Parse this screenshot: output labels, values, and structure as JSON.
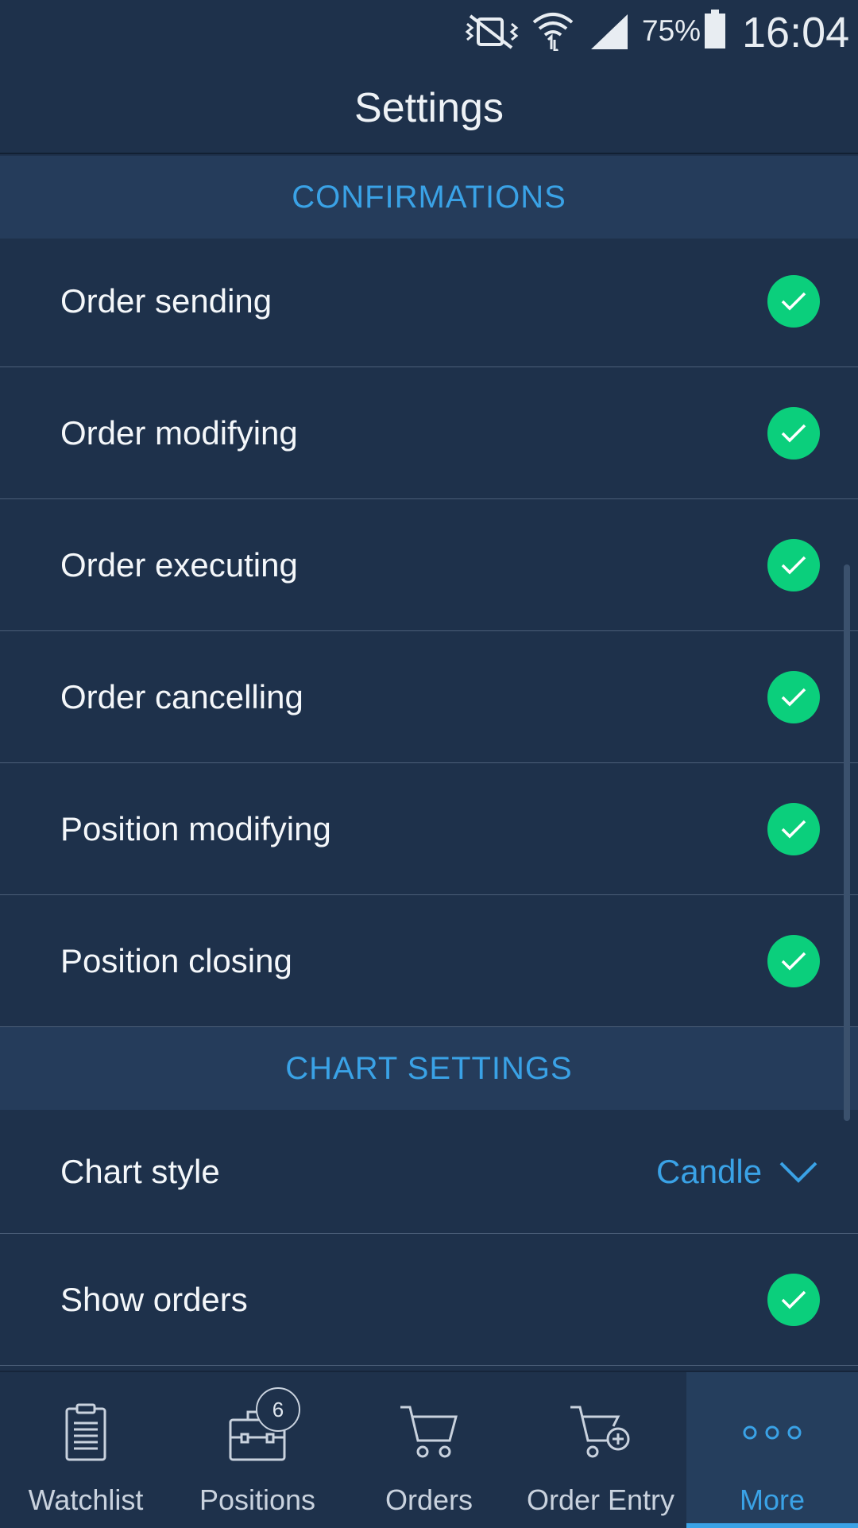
{
  "status_bar": {
    "battery_percent": "75%",
    "time": "16:04",
    "icons": [
      "vibrate-off-icon",
      "wifi-icon",
      "signal-icon",
      "battery-icon"
    ]
  },
  "header": {
    "title": "Settings"
  },
  "sections": {
    "confirmations": {
      "title": "CONFIRMATIONS",
      "items": [
        {
          "label": "Order sending",
          "checked": true
        },
        {
          "label": "Order modifying",
          "checked": true
        },
        {
          "label": "Order executing",
          "checked": true
        },
        {
          "label": "Order cancelling",
          "checked": true
        },
        {
          "label": "Position modifying",
          "checked": true
        },
        {
          "label": "Position closing",
          "checked": true
        }
      ]
    },
    "chart_settings": {
      "title": "CHART SETTINGS",
      "chart_style": {
        "label": "Chart style",
        "value": "Candle"
      },
      "show_orders": {
        "label": "Show orders",
        "checked": true
      }
    }
  },
  "bottom_nav": {
    "items": [
      {
        "label": "Watchlist",
        "icon": "clipboard-icon"
      },
      {
        "label": "Positions",
        "icon": "briefcase-icon",
        "badge": "6"
      },
      {
        "label": "Orders",
        "icon": "cart-icon"
      },
      {
        "label": "Order Entry",
        "icon": "cart-add-icon"
      },
      {
        "label": "More",
        "icon": "more-dots-icon",
        "active": true
      }
    ]
  },
  "colors": {
    "background": "#1e314b",
    "section_header": "#253c5b",
    "accent": "#3aa2e6",
    "check": "#0bcf7c"
  }
}
